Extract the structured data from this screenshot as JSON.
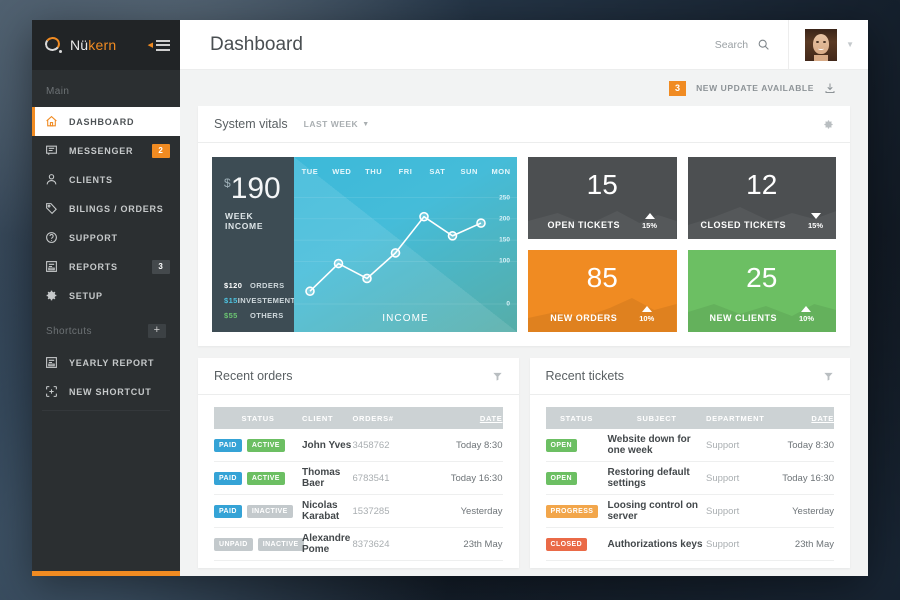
{
  "sidebar": {
    "brand": {
      "part1": "Nü",
      "part2": "kern"
    },
    "section_main": "Main",
    "section_shortcuts": "Shortcuts",
    "add_shortcut_label": "+",
    "items": [
      {
        "label": "DASHBOARD",
        "icon": "home-icon",
        "badge": "",
        "active": true
      },
      {
        "label": "MESSENGER",
        "icon": "chat-icon",
        "badge": "2",
        "active": false
      },
      {
        "label": "CLIENTS",
        "icon": "user-icon",
        "badge": "",
        "active": false
      },
      {
        "label": "BILINGS / ORDERS",
        "icon": "tag-icon",
        "badge": "",
        "active": false
      },
      {
        "label": "SUPPORT",
        "icon": "help-icon",
        "badge": "",
        "active": false
      },
      {
        "label": "REPORTS",
        "icon": "report-icon",
        "badge": "3",
        "active": false
      },
      {
        "label": "SETUP",
        "icon": "gear-icon",
        "badge": "",
        "active": false
      }
    ],
    "shortcuts": [
      {
        "label": "YEARLY REPORT",
        "icon": "report-icon"
      },
      {
        "label": "NEW SHORTCUT",
        "icon": "plus-square-icon"
      }
    ]
  },
  "header": {
    "title": "Dashboard",
    "search_label": "Search",
    "search_icon": "search-icon",
    "avatar_caret": "▼",
    "update_badge": "3",
    "update_text": "NEW UPDATE AVAILABLE",
    "download_icon": "download-icon"
  },
  "vitals": {
    "title": "System vitals",
    "range_label": "LAST WEEK",
    "range_caret": "▼",
    "settings_icon": "gear-icon"
  },
  "income": {
    "currency": "$",
    "amount": "190",
    "caption": "WEEK INCOME",
    "footer": "INCOME",
    "legend": [
      {
        "value": "$120",
        "label": "ORDERS"
      },
      {
        "value": "$15",
        "label": "INVESTEMENT"
      },
      {
        "value": "$55",
        "label": "OTHERS"
      }
    ]
  },
  "tiles": [
    {
      "value": "15",
      "label": "OPEN TICKETS",
      "pct": "15%",
      "trend": "up",
      "color": "#4c4f51"
    },
    {
      "value": "12",
      "label": "CLOSED TICKETS",
      "pct": "15%",
      "trend": "down",
      "color": "#4c4f51"
    },
    {
      "value": "85",
      "label": "NEW ORDERS",
      "pct": "10%",
      "trend": "up",
      "color": "#f08b22"
    },
    {
      "value": "25",
      "label": "NEW CLIENTS",
      "pct": "10%",
      "trend": "up",
      "color": "#6cbf63"
    }
  ],
  "orders": {
    "title": "Recent orders",
    "filter_icon": "filter-icon",
    "columns": [
      "STATUS",
      "CLIENT",
      "ORDERS#",
      "DATE"
    ],
    "rows": [
      {
        "badges": [
          {
            "text": "PAID",
            "color": "blue"
          },
          {
            "text": "ACTIVE",
            "color": "green"
          }
        ],
        "client": "John Yves",
        "order": "3458762",
        "date": "Today 8:30"
      },
      {
        "badges": [
          {
            "text": "PAID",
            "color": "blue"
          },
          {
            "text": "ACTIVE",
            "color": "green"
          }
        ],
        "client": "Thomas Baer",
        "order": "6783541",
        "date": "Today 16:30"
      },
      {
        "badges": [
          {
            "text": "PAID",
            "color": "blue"
          },
          {
            "text": "INACTIVE",
            "color": "gray"
          }
        ],
        "client": "Nicolas Karabat",
        "order": "1537285",
        "date": "Yesterday"
      },
      {
        "badges": [
          {
            "text": "UNPAID",
            "color": "gray"
          },
          {
            "text": "INACTIVE",
            "color": "gray"
          }
        ],
        "client": "Alexandre Pome",
        "order": "8373624",
        "date": "23th May"
      }
    ]
  },
  "tickets": {
    "title": "Recent tickets",
    "filter_icon": "filter-icon",
    "columns": [
      "STATUS",
      "SUBJECT",
      "DEPARTMENT",
      "DATE"
    ],
    "rows": [
      {
        "badge": {
          "text": "OPEN",
          "color": "green"
        },
        "subject": "Website down for one week",
        "dept": "Support",
        "date": "Today 8:30"
      },
      {
        "badge": {
          "text": "OPEN",
          "color": "green"
        },
        "subject": "Restoring default settings",
        "dept": "Support",
        "date": "Today 16:30"
      },
      {
        "badge": {
          "text": "PROGRESS",
          "color": "orange"
        },
        "subject": "Loosing control on server",
        "dept": "Support",
        "date": "Yesterday"
      },
      {
        "badge": {
          "text": "CLOSED",
          "color": "red"
        },
        "subject": "Authorizations keys",
        "dept": "Support",
        "date": "23th May"
      }
    ]
  },
  "chart_data": {
    "type": "line",
    "title": "INCOME",
    "xlabel": "",
    "ylabel": "",
    "categories": [
      "TUE",
      "WED",
      "THU",
      "FRI",
      "SAT",
      "SUN",
      "MON"
    ],
    "values": [
      30,
      95,
      60,
      120,
      205,
      160,
      190
    ],
    "ytick_labels": [
      "250",
      "200",
      "150",
      "100",
      "0"
    ],
    "ytick_values": [
      250,
      200,
      150,
      100,
      0
    ],
    "ylim": [
      0,
      270
    ],
    "grid": true,
    "legend": "none",
    "series_color": "#ffffff",
    "marker": "circle-open"
  }
}
